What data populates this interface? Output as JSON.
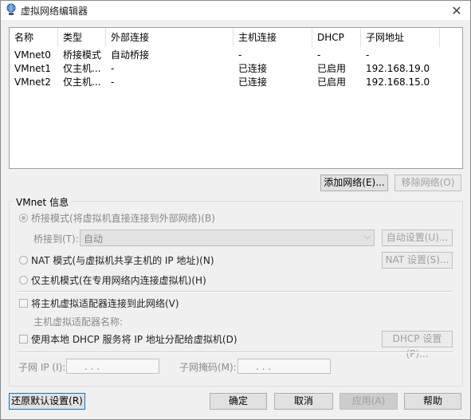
{
  "window": {
    "title": "虚拟网络编辑器",
    "close_glyph": "✕"
  },
  "list": {
    "headers": [
      "名称",
      "类型",
      "外部连接",
      "主机连接",
      "DHCP",
      "子网地址"
    ],
    "rows": [
      [
        "VMnet0",
        "桥接模式",
        "自动桥接",
        "-",
        "-",
        "-"
      ],
      [
        "VMnet1",
        "仅主机...",
        "-",
        "已连接",
        "已启用",
        "192.168.19.0"
      ],
      [
        "VMnet2",
        "仅主机...",
        "-",
        "已连接",
        "已启用",
        "192.168.15.0"
      ]
    ]
  },
  "buttons": {
    "add_network": "添加网络(E)...",
    "remove_network": "移除网络(O)",
    "auto_settings": "自动设置(U)...",
    "nat_settings": "NAT 设置(S)...",
    "dhcp_settings": "DHCP 设置(P)...",
    "restore_defaults": "还原默认设置(R)",
    "ok": "确定",
    "cancel": "取消",
    "apply": "应用(A)",
    "help": "帮助"
  },
  "vmnet_info": {
    "group_title": "VMnet 信息",
    "bridged_label": "桥接模式(将虚拟机直接连接到外部网络)(B)",
    "bridge_to_label": "桥接到(T):",
    "bridge_to_value": "自动",
    "nat_label": "NAT 模式(与虚拟机共享主机的 IP 地址)(N)",
    "host_only_label": "仅主机模式(在专用网络内连接虚拟机)(H)",
    "connect_adapter_label": "将主机虚拟适配器连接到此网络(V)",
    "adapter_name_label": "主机虚拟适配器名称:",
    "dhcp_label": "使用本地 DHCP 服务将 IP 地址分配给虚拟机(D)",
    "subnet_ip_label": "子网 IP (I):",
    "subnet_mask_label": "子网掩码(M):",
    "ip_dots": ".   .   ."
  },
  "icons": {
    "app_icon": "network-globe-icon",
    "dropdown": "chevron-down-icon"
  }
}
